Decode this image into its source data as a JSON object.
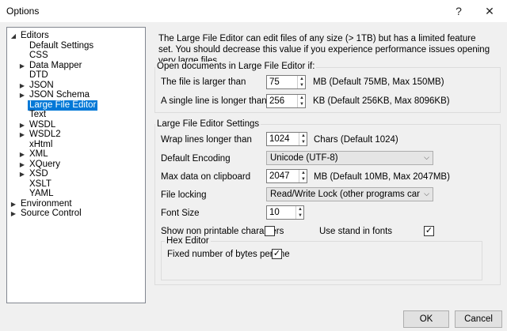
{
  "window": {
    "title": "Options",
    "help_glyph": "?",
    "close_glyph": "✕"
  },
  "tree": {
    "items": [
      {
        "label": "Editors",
        "arrow": "◢"
      },
      {
        "label": "Default Settings",
        "arrow": ""
      },
      {
        "label": "CSS",
        "arrow": ""
      },
      {
        "label": "Data Mapper",
        "arrow": "▶"
      },
      {
        "label": "DTD",
        "arrow": ""
      },
      {
        "label": "JSON",
        "arrow": "▶"
      },
      {
        "label": "JSON Schema",
        "arrow": "▶"
      },
      {
        "label": "Large File Editor",
        "arrow": ""
      },
      {
        "label": "Text",
        "arrow": ""
      },
      {
        "label": "WSDL",
        "arrow": "▶"
      },
      {
        "label": "WSDL2",
        "arrow": "▶"
      },
      {
        "label": "xHtml",
        "arrow": ""
      },
      {
        "label": "XML",
        "arrow": "▶"
      },
      {
        "label": "XQuery",
        "arrow": "▶"
      },
      {
        "label": "XSD",
        "arrow": "▶"
      },
      {
        "label": "XSLT",
        "arrow": ""
      },
      {
        "label": "YAML",
        "arrow": ""
      },
      {
        "label": "Environment",
        "arrow": "▶"
      },
      {
        "label": "Source Control",
        "arrow": "▶"
      }
    ]
  },
  "main": {
    "description": "The Large File Editor can edit files of any size (> 1TB) but has a limited feature set. You should decrease this value if you experience performance issues opening very large files.",
    "open_group": {
      "title": "Open documents in Large File Editor if:",
      "file_larger_label": "The file is larger than",
      "file_larger_value": "75",
      "file_larger_hint": "MB (Default 75MB, Max 150MB)",
      "line_longer_label": "A single line is longer than",
      "line_longer_value": "256",
      "line_longer_hint": "KB (Default 256KB, Max 8096KB)"
    },
    "settings_group": {
      "title": "Large File Editor Settings",
      "wrap_label": "Wrap lines longer than",
      "wrap_value": "1024",
      "wrap_hint": "Chars (Default 1024)",
      "encoding_label": "Default Encoding",
      "encoding_value": "Unicode (UTF-8)",
      "clipboard_label": "Max data on clipboard",
      "clipboard_value": "2047",
      "clipboard_hint": "MB (Default 10MB, Max 2047MB)",
      "locking_label": "File locking",
      "locking_value": "Read/Write Lock (other programs can not acces",
      "font_size_label": "Font Size",
      "font_size_value": "10",
      "nonprint_label": "Show non printable characters",
      "nonprint_checked": false,
      "standin_label": "Use stand in fonts",
      "standin_checked": true
    },
    "hex_group": {
      "title": "Hex Editor",
      "fixed_bytes_label": "Fixed number of bytes per line",
      "fixed_bytes_checked": true
    }
  },
  "footer": {
    "ok_label": "OK",
    "cancel_label": "Cancel"
  },
  "glyphs": {
    "check": "✓",
    "spin_up": "▲",
    "spin_down": "▼",
    "combo_arrow": "⌵"
  }
}
